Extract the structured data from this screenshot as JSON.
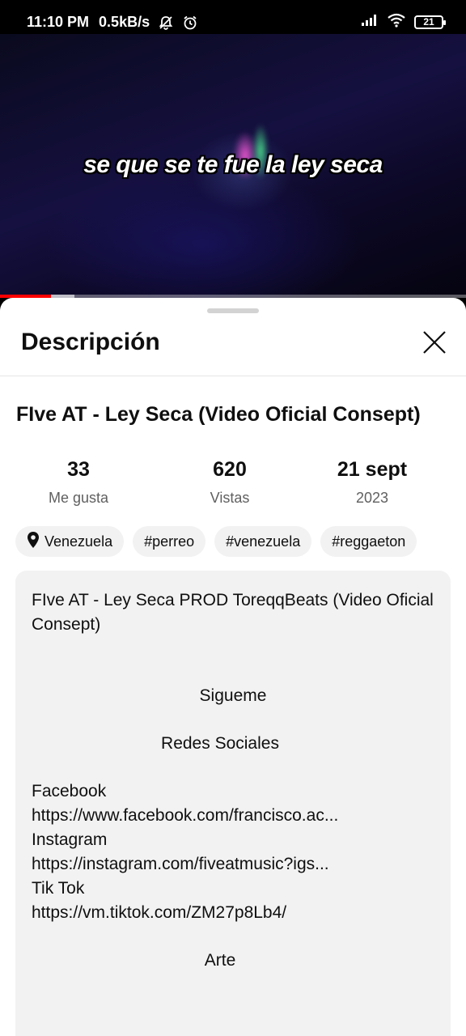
{
  "status_bar": {
    "time": "11:10 PM",
    "net_speed": "0.5kB/s",
    "battery": "21"
  },
  "video": {
    "subtitle": "se que se te fue la ley seca",
    "progress_played_percent": 11,
    "progress_buffered_percent": 16
  },
  "sheet": {
    "title": "Descripción",
    "video_title": "FIve AT - Ley Seca (Video Oficial Consept)",
    "stats": {
      "likes": {
        "value": "33",
        "label": "Me gusta"
      },
      "views": {
        "value": "620",
        "label": "Vistas"
      },
      "date": {
        "value": "21 sept",
        "label": "2023"
      }
    },
    "chips": {
      "location": "Venezuela",
      "tags": [
        "#perreo",
        "#venezuela",
        "#reggaeton"
      ]
    },
    "description": {
      "line1": "FIve AT - Ley Seca PROD ToreqqBeats (Video Oficial Consept)",
      "sigueme": "Sigueme",
      "redes": "Redes Sociales",
      "facebook_label": "Facebook",
      "facebook_url": "https://www.facebook.com/francisco.ac...",
      "instagram_label": "Instagram",
      "instagram_url": "https://instagram.com/fiveatmusic?igs...",
      "tiktok_label": "Tik Tok",
      "tiktok_url": "https://vm.tiktok.com/ZM27p8Lb4/",
      "arte": "Arte"
    }
  },
  "icons": {
    "status": [
      "bell-off-icon",
      "alarm-icon",
      "signal-icon",
      "wifi-icon",
      "battery-icon"
    ],
    "sheet": [
      "close-icon",
      "location-pin-icon"
    ]
  }
}
